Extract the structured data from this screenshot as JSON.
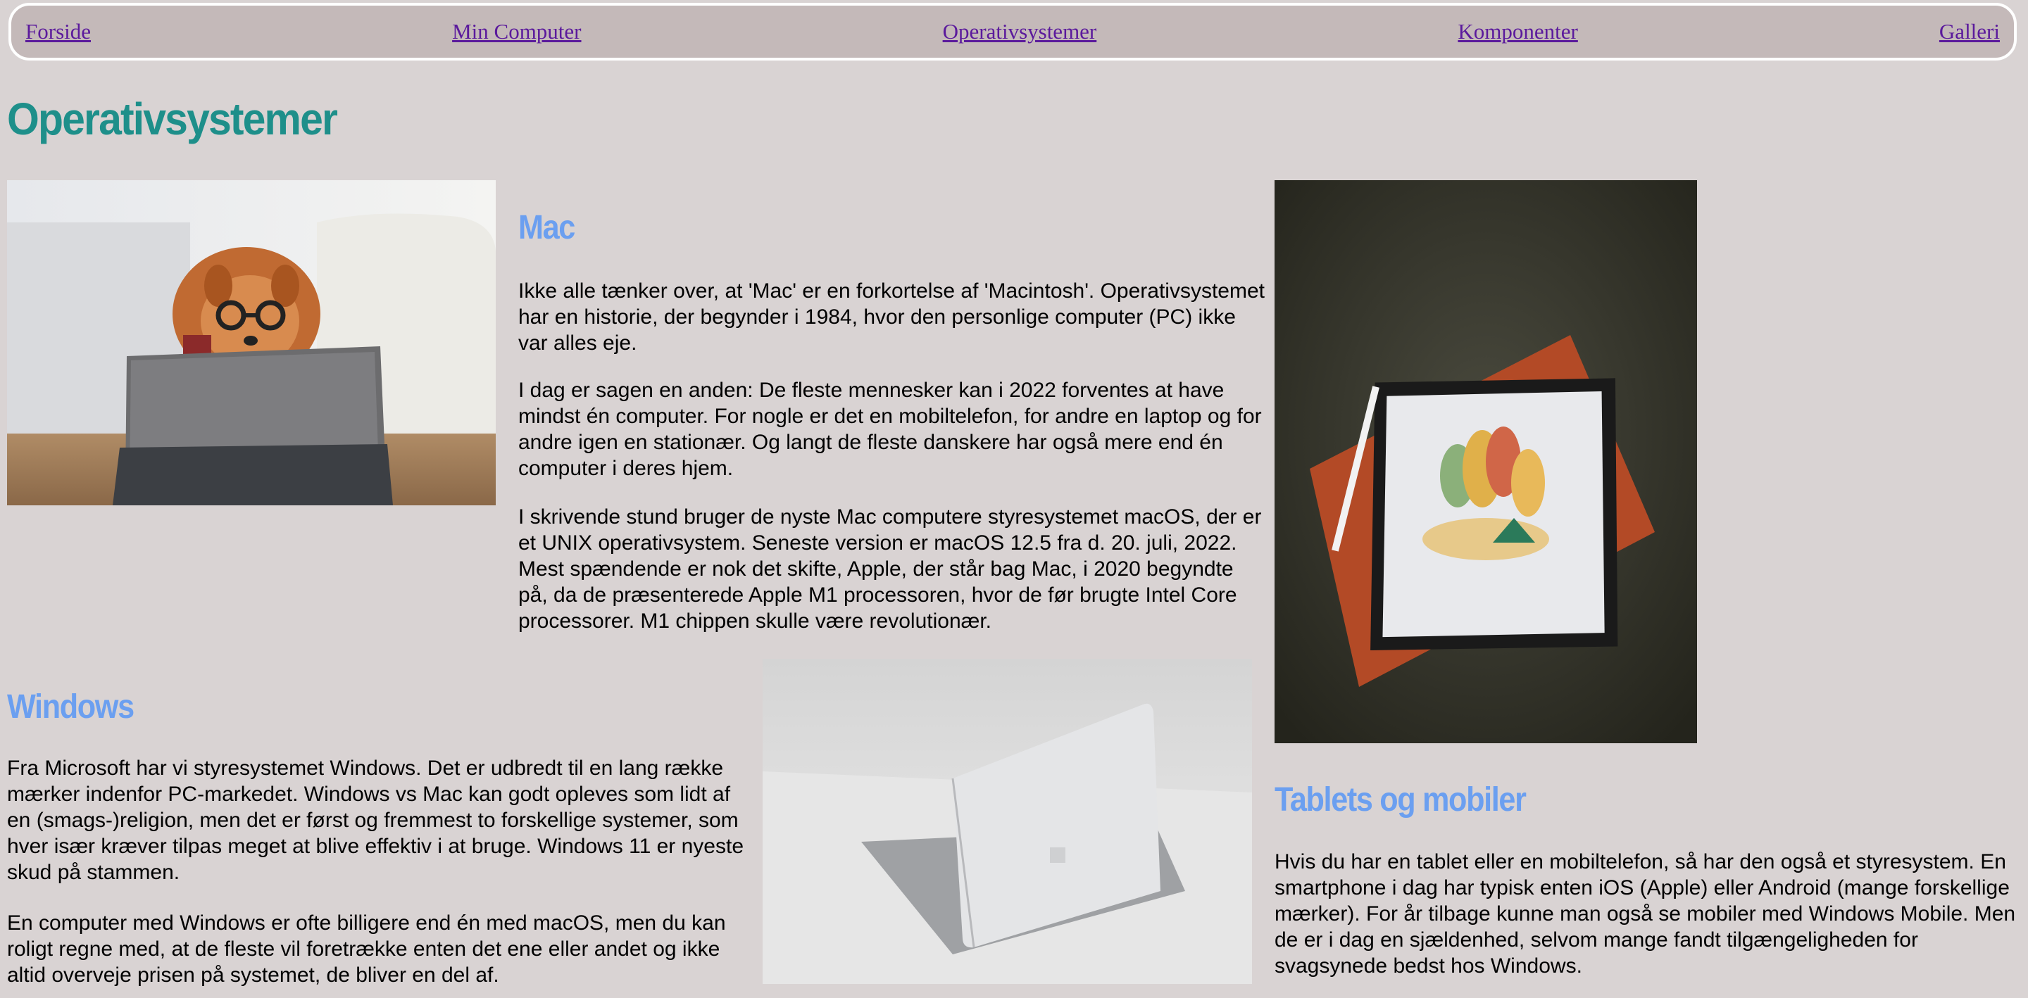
{
  "nav": {
    "items": [
      "Forside",
      "Min Computer",
      "Operativsystemer",
      "Komponenter",
      "Galleri"
    ]
  },
  "page_title": "Operativsystemer",
  "mac": {
    "heading": "Mac",
    "paragraphs": [
      "Ikke alle tænker over, at 'Mac' er en forkortelse af 'Macintosh'. Operativsystemet har en historie, der begynder i 1984, hvor den personlige computer (PC) ikke var alles eje.",
      "I dag er sagen en anden: De fleste mennesker kan i 2022 forventes at have mindst én computer. For nogle er det en mobiltelefon, for andre en laptop og for andre igen en stationær. Og langt de fleste danskere har også mere end én computer i deres hjem.",
      "I skrivende stund bruger de nyste Mac computere styresystemet macOS, der er et UNIX operativsystem. Seneste version er macOS 12.5 fra d. 20. juli, 2022. Mest spændende er nok det skifte, Apple, der står bag Mac, i 2020 begyndte på, da de præsenterede Apple M1 processoren, hvor de før brugte Intel Core processorer. M1 chippen skulle være revolutionær."
    ]
  },
  "windows": {
    "heading": "Windows",
    "paragraphs": [
      "Fra Microsoft har vi styresystemet Windows. Det er udbredt til en lang række mærker indenfor PC-markedet. Windows vs Mac kan godt opleves som lidt af en (smags-)religion, men det er først og fremmest to forskellige systemer, som hver især kræver tilpas meget at blive effektiv i at bruge. Windows 11 er nyeste skud på stammen.",
      "En computer med Windows er ofte billigere end én med macOS, men du kan roligt regne med, at de fleste vil foretrække enten det ene eller andet og ikke altid overveje prisen på systemet, de bliver en del af."
    ]
  },
  "tablets": {
    "heading": "Tablets og mobiler",
    "paragraphs": [
      "Hvis du har en tablet eller en mobiltelefon, så har den også et styresystem. En smartphone i dag har typisk enten iOS (Apple) eller Android (mange forskellige mærker). For år tilbage kunne man også se mobiler med Windows Mobile. Men de er i dag en sjældenhed, selvom mange fandt tilgængeligheden for svagsynede bedst hos Windows."
    ]
  },
  "colors": {
    "background": "#d9d3d3",
    "nav_background": "#c4b9b9",
    "link": "#5b1a9c",
    "title": "#1e8f8a",
    "heading": "#6b9ff0"
  }
}
